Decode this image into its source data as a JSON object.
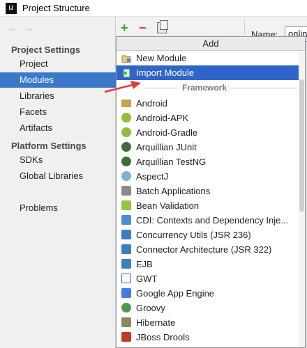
{
  "window": {
    "app_icon_text": "IJ",
    "title": "Project Structure"
  },
  "sidebar": {
    "nav_back": "←",
    "nav_forward": "→",
    "section_project_settings": "Project Settings",
    "section_platform_settings": "Platform Settings",
    "items": [
      {
        "label": "Project"
      },
      {
        "label": "Modules"
      },
      {
        "label": "Libraries"
      },
      {
        "label": "Facets"
      },
      {
        "label": "Artifacts"
      },
      {
        "label": "SDKs"
      },
      {
        "label": "Global Libraries"
      },
      {
        "label": "Problems"
      }
    ],
    "selected_item": "Modules"
  },
  "toolbar": {
    "add_symbol": "+",
    "remove_symbol": "−"
  },
  "name_field": {
    "label": "Name:",
    "value": "onlin"
  },
  "popup": {
    "header": "Add",
    "top_items": [
      {
        "label": "New Module",
        "icon": "folder-module-icon"
      },
      {
        "label": "Import Module",
        "icon": "import-module-icon"
      }
    ],
    "selected_item": "Import Module",
    "separator_label": "Framework",
    "framework_items": [
      {
        "label": "Android",
        "icon": "folder-icon",
        "color": "#c9a24b"
      },
      {
        "label": "Android-APK",
        "icon": "android-icon",
        "color": "#8fbf3a"
      },
      {
        "label": "Android-Gradle",
        "icon": "android-icon",
        "color": "#8fbf3a"
      },
      {
        "label": "Arquillian JUnit",
        "icon": "arquillian-icon",
        "color": "#3d6b3a"
      },
      {
        "label": "Arquillian TestNG",
        "icon": "arquillian-icon",
        "color": "#3d6b3a"
      },
      {
        "label": "AspectJ",
        "icon": "aspectj-icon",
        "color": "#7fb0d8"
      },
      {
        "label": "Batch Applications",
        "icon": "batch-icon",
        "color": "#8a8a8a"
      },
      {
        "label": "Bean Validation",
        "icon": "bean-validation-icon",
        "color": "#9ac43c"
      },
      {
        "label": "CDI: Contexts and Dependency Inje...",
        "icon": "cdi-icon",
        "color": "#4a8fd0"
      },
      {
        "label": "Concurrency Utils (JSR 236)",
        "icon": "jsr-icon",
        "color": "#3a7fc0"
      },
      {
        "label": "Connector Architecture (JSR 322)",
        "icon": "jsr-icon",
        "color": "#3a7fc0"
      },
      {
        "label": "EJB",
        "icon": "ejb-icon",
        "color": "#3a7fc0"
      },
      {
        "label": "GWT",
        "icon": "gwt-icon",
        "color": "#2f65ca"
      },
      {
        "label": "Google App Engine",
        "icon": "app-engine-icon",
        "color": "#3e7fe0"
      },
      {
        "label": "Groovy",
        "icon": "groovy-icon",
        "color": "#4f9a4f"
      },
      {
        "label": "Hibernate",
        "icon": "hibernate-icon",
        "color": "#8a8a5a"
      },
      {
        "label": "JBoss Drools",
        "icon": "jboss-icon",
        "color": "#c0392b"
      }
    ]
  },
  "colors": {
    "selection": "#2f65ca",
    "sidebar_selection": "#3b78c9",
    "arrow": "#e53935"
  }
}
